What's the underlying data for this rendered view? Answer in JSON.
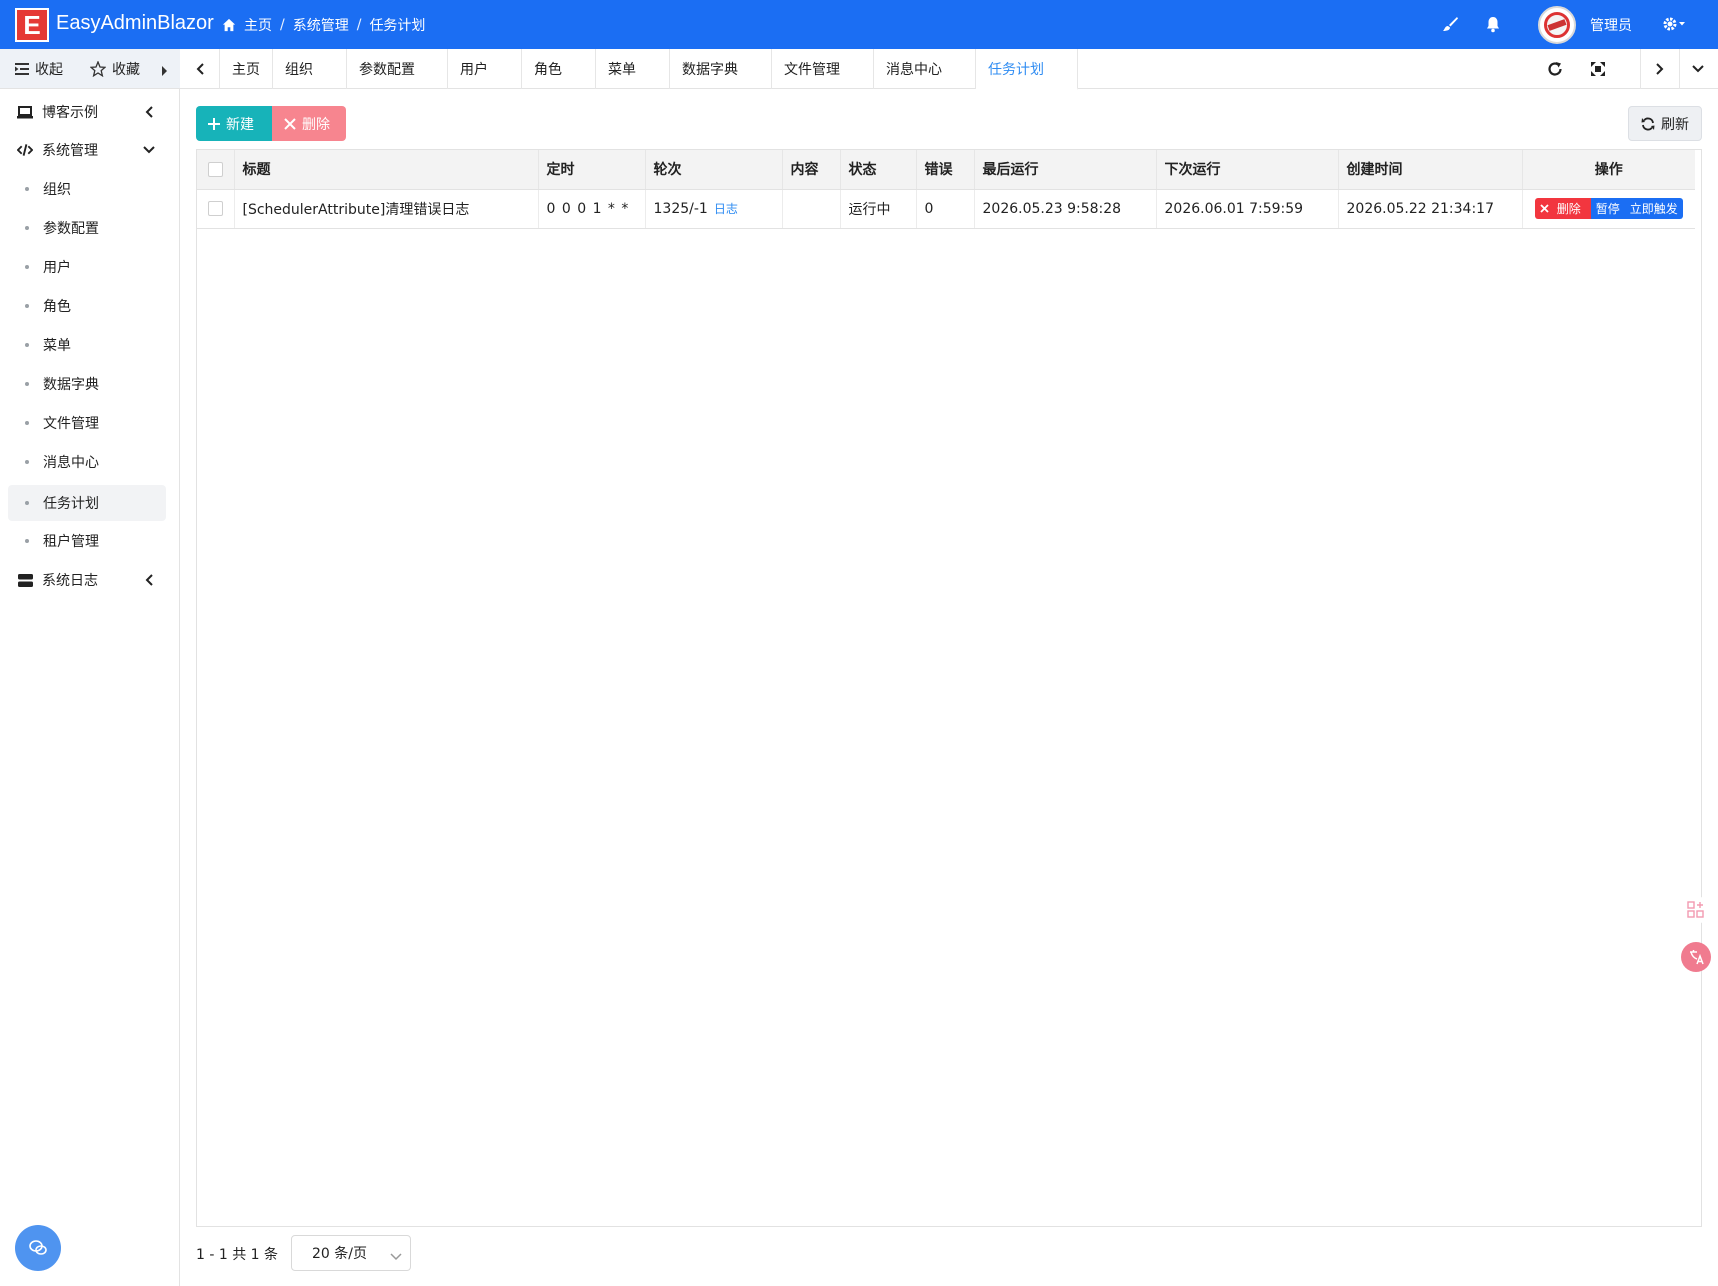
{
  "header": {
    "logo_letter": "E",
    "app_title": "EasyAdminBlazor",
    "breadcrumb": [
      "主页",
      "系统管理",
      "任务计划"
    ],
    "breadcrumb_sep": "/",
    "user_name": "管理员",
    "accent_color": "#1b6ef3"
  },
  "left_tools": {
    "collapse_label": "收起",
    "favorites_label": "收藏"
  },
  "tabs": [
    {
      "label": "主页"
    },
    {
      "label": "组织"
    },
    {
      "label": "参数配置"
    },
    {
      "label": "用户"
    },
    {
      "label": "角色"
    },
    {
      "label": "菜单"
    },
    {
      "label": "数据字典"
    },
    {
      "label": "文件管理"
    },
    {
      "label": "消息中心"
    },
    {
      "label": "任务计划",
      "active": true
    }
  ],
  "sidebar": {
    "groups": [
      {
        "label": "博客示例",
        "icon": "laptop-icon",
        "expanded": false
      },
      {
        "label": "系统管理",
        "icon": "code-icon",
        "expanded": true
      },
      {
        "label": "系统日志",
        "icon": "server-icon",
        "expanded": false
      }
    ],
    "items": [
      {
        "label": "组织"
      },
      {
        "label": "参数配置"
      },
      {
        "label": "用户"
      },
      {
        "label": "角色"
      },
      {
        "label": "菜单"
      },
      {
        "label": "数据字典"
      },
      {
        "label": "文件管理"
      },
      {
        "label": "消息中心"
      },
      {
        "label": "任务计划",
        "active": true
      },
      {
        "label": "租户管理"
      }
    ]
  },
  "toolbar": {
    "new_label": "新建",
    "delete_label": "删除",
    "refresh_label": "刷新"
  },
  "table": {
    "columns": [
      "标题",
      "定时",
      "轮次",
      "内容",
      "状态",
      "错误",
      "最后运行",
      "下次运行",
      "创建时间",
      "操作"
    ],
    "rows": [
      {
        "title": "[SchedulerAttribute]清理错误日志",
        "cron": "0 0 0 1 * *",
        "round": "1325/-1",
        "log_link": "日志",
        "content": "",
        "status": "运行中",
        "errors": "0",
        "last_run": "2026.05.23 9:58:28",
        "next_run": "2026.06.01 7:59:59",
        "created": "2026.05.22 21:34:17",
        "op_delete": "删除",
        "op_pause": "暂停",
        "op_trigger": "立即触发"
      }
    ]
  },
  "pager": {
    "summary": "1 - 1 共 1 条",
    "page_size": "20 条/页"
  }
}
